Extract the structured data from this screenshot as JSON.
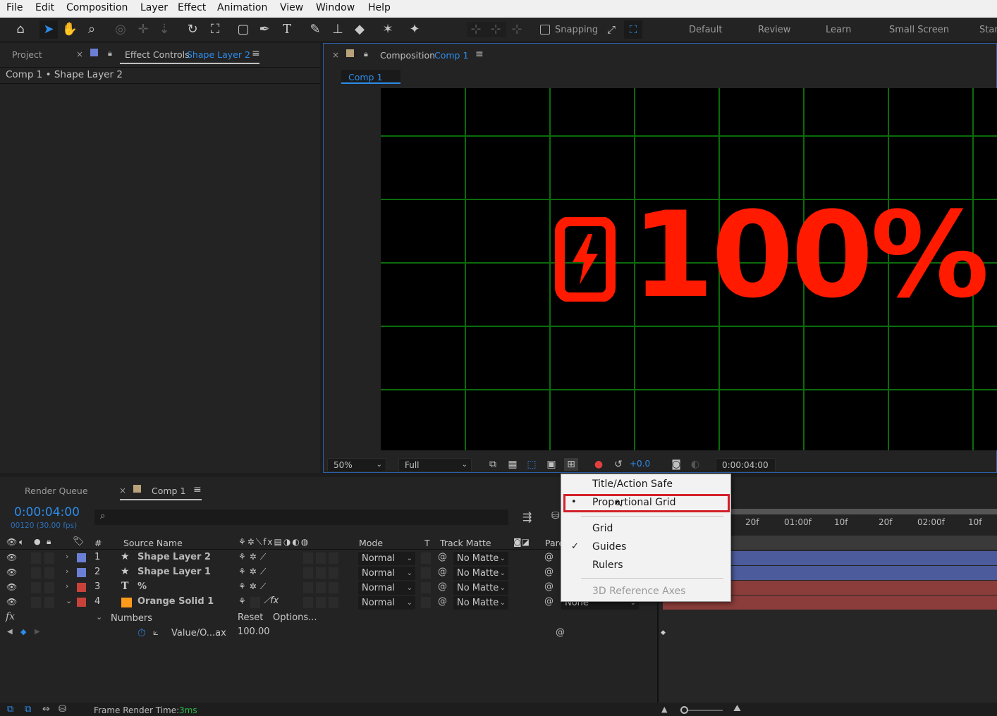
{
  "menu": [
    "File",
    "Edit",
    "Composition",
    "Layer",
    "Effect",
    "Animation",
    "View",
    "Window",
    "Help"
  ],
  "toolbar": {
    "snapping_label": "Snapping",
    "workspaces": [
      "Default",
      "Review",
      "Learn",
      "Small Screen",
      "Stan"
    ]
  },
  "left_panel": {
    "project_tab": "Project",
    "effect_controls_tab": "Effect Controls",
    "effect_controls_layer": "Shape Layer 2",
    "breadcrumb": "Comp 1 • Shape Layer 2"
  },
  "comp_panel": {
    "tab_label": "Composition",
    "tab_comp": "Comp 1",
    "sub_tab": "Comp 1",
    "display_text": "100%",
    "zoom": "50%",
    "resolution": "Full",
    "exposure": "+0.0",
    "timecode": "0:00:04:00"
  },
  "timeline": {
    "render_queue_tab": "Render Queue",
    "comp_tab": "Comp 1",
    "current_time": "0:00:04:00",
    "frame_info": "00120 (30.00 fps)",
    "columns": {
      "number": "#",
      "source_name": "Source Name",
      "mode": "Mode",
      "t": "T",
      "track_matte": "Track Matte",
      "parent": "Pare"
    },
    "layers": [
      {
        "num": "1",
        "name": "Shape Layer 2",
        "icon": "star-icon",
        "color": "#6b7fd6",
        "mode": "Normal",
        "matte": "No Matte"
      },
      {
        "num": "2",
        "name": "Shape Layer 1",
        "icon": "star-icon",
        "color": "#6b7fd6",
        "mode": "Normal",
        "matte": "No Matte"
      },
      {
        "num": "3",
        "name": "%",
        "icon": "text-layer-icon",
        "color": "#c8423a",
        "mode": "Normal",
        "matte": "No Matte"
      },
      {
        "num": "4",
        "name": "Orange Solid 1",
        "icon": "solid-swatch",
        "color": "#c8423a",
        "mode": "Normal",
        "matte": "No Matte"
      }
    ],
    "parent_value": "None",
    "effect_name": "Numbers",
    "reset_label": "Reset",
    "options_label": "Options...",
    "property_name": "Value/O...ax",
    "property_value": "100.00",
    "ruler_ticks": [
      "20f",
      "01:00f",
      "10f",
      "20f",
      "02:00f",
      "10f"
    ],
    "footer_render_label": "Frame Render Time:",
    "footer_render_value": "3ms"
  },
  "popup_menu": {
    "items": [
      {
        "label": "Title/Action Safe",
        "mark": "",
        "enabled": true
      },
      {
        "label": "Proportional Grid",
        "mark": "•",
        "enabled": true,
        "highlighted": true
      },
      {
        "label": "Grid",
        "mark": "",
        "enabled": true
      },
      {
        "label": "Guides",
        "mark": "✓",
        "enabled": true
      },
      {
        "label": "Rulers",
        "mark": "",
        "enabled": true
      },
      {
        "label": "3D Reference Axes",
        "mark": "",
        "enabled": false
      }
    ]
  },
  "colors": {
    "accent_blue": "#2d8ceb",
    "highlight_red": "#d2202a",
    "grid_green": "#0b6b0b",
    "text_red": "#ff1a00"
  }
}
